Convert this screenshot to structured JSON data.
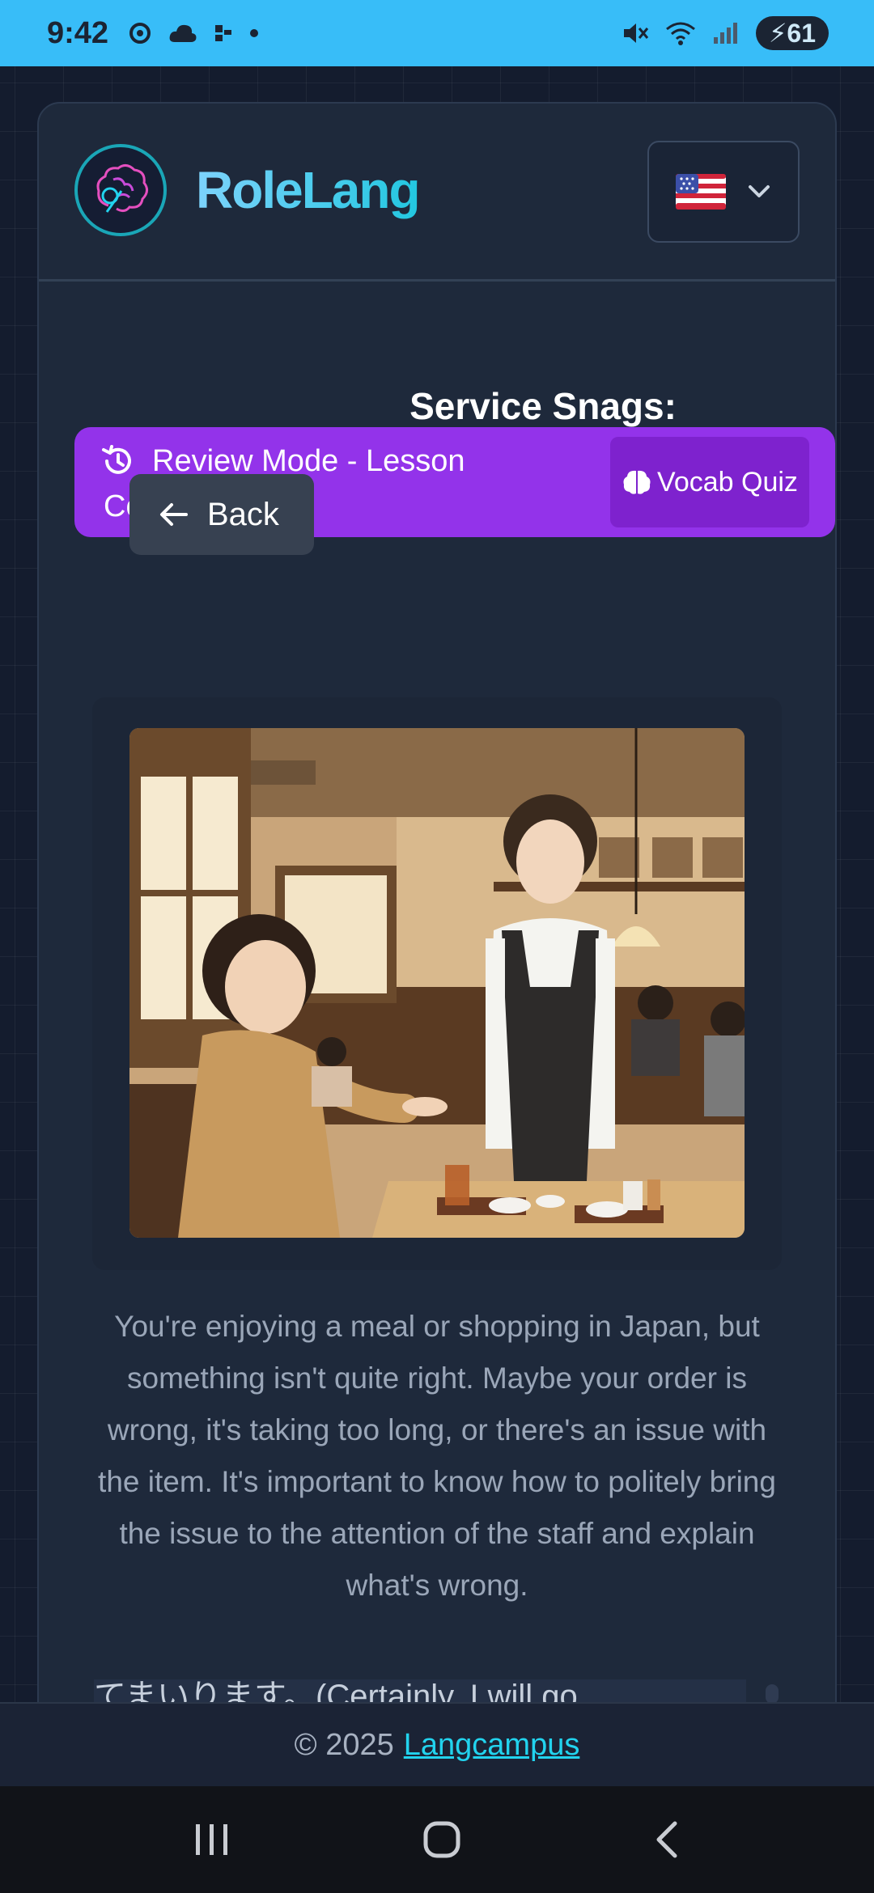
{
  "status_bar": {
    "time": "9:42",
    "battery": "61"
  },
  "header": {
    "app_name": "RoleLang",
    "language_flag": "us-flag"
  },
  "lesson": {
    "title": "Service Snags: Complaining in Japanese",
    "review_label": "Review Mode - Lesson Completed",
    "vocab_quiz_label": "Vocab Quiz",
    "back_label": "Back",
    "description": "You're enjoying a meal or shopping in Japan, but something isn't quite right. Maybe your order is wrong, it's taking too long, or there's an issue with the item. It's important to know how to politely bring the issue to the attention of the staff and explain what's wrong.",
    "dialogue_peek": "てまいります。(Certainly, I will go"
  },
  "footer": {
    "copyright": "© 2025",
    "link_text": "Langcampus"
  },
  "colors": {
    "status_bar": "#38bdf8",
    "review_bar": "#9333ea",
    "vocab_button": "#7e22ce",
    "accent": "#22d3ee"
  },
  "icons": [
    "history-icon",
    "brain-icon",
    "arrow-left-icon",
    "chevron-down-icon",
    "recent-apps-icon",
    "home-icon",
    "back-nav-icon"
  ]
}
